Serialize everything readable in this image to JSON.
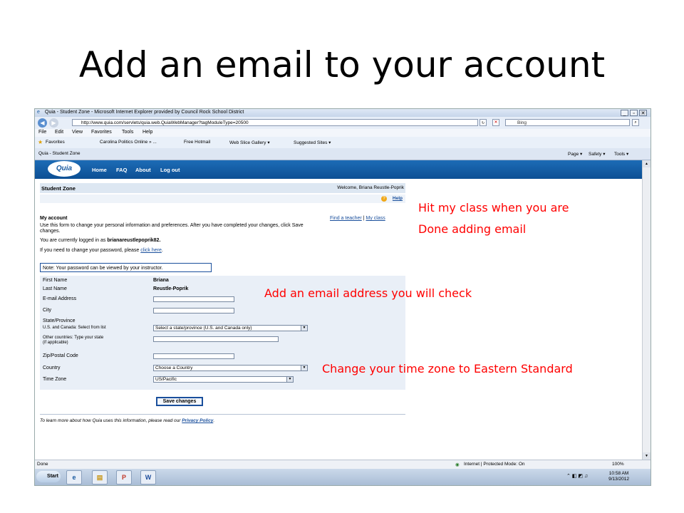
{
  "slide": {
    "title": "Add an email to your account"
  },
  "browser": {
    "window_title": "Quia - Student Zone - Microsoft Internet Explorer provided by Council Rock School District",
    "address": "http://www.quia.com/servlets/quia.web.QuiaWebManager?tagModuleType=20500",
    "search_placeholder": "Bing",
    "menu": [
      "File",
      "Edit",
      "View",
      "Favorites",
      "Tools",
      "Help"
    ],
    "favorites": {
      "label": "Favorites",
      "items": [
        "Carolina Politics Online » ...",
        "Free Hotmail",
        "Web Slice Gallery ▾",
        "Suggested Sites ▾"
      ]
    },
    "tab": "Quia - Student Zone",
    "toolbar": [
      "Page ▾",
      "Safety ▾",
      "Tools ▾"
    ],
    "status_left": "Done",
    "status_zone": "Internet | Protected Mode: On",
    "zoom": "100%"
  },
  "quia": {
    "logo": "Quia",
    "nav": [
      "Home",
      "FAQ",
      "About",
      "Log out"
    ],
    "section": "Student Zone",
    "welcome": "Welcome, Briana Reustle-Poprik",
    "help": "Help",
    "my_account": "My account",
    "find_teacher": "Find a teacher",
    "sep": "|",
    "my_class": "My class",
    "intro_1": "Use this form to change your personal information and preferences. After you have completed your changes, click Save",
    "intro_2": "changes.",
    "logged_in_prefix": "You are currently logged in as ",
    "username": "brianareustlepoprik82.",
    "password_prefix": "If you need to change your password, please ",
    "click_here": "click here",
    "password_suffix": ".",
    "note": "Note: Your password can be viewed by your instructor.",
    "form": {
      "first_name_label": "First Name",
      "first_name": "Briana",
      "last_name_label": "Last Name",
      "last_name": "Reustle-Poprik",
      "email_label": "E-mail Address",
      "email": "",
      "city_label": "City",
      "city": "",
      "state_label": "State/Province",
      "state_sub": "U.S. and Canada: Select from list",
      "state_value": "Select a state/province (U.S. and Canada only)",
      "other_label_1": "Other countries: Type your state",
      "other_label_2": "(if applicable)",
      "zip_label": "Zip/Postal Code",
      "country_label": "Country",
      "country_value": "Choose a Country",
      "tz_label": "Time Zone",
      "tz_value": "US/Pacific"
    },
    "save": "Save changes",
    "footer_prefix": "To learn more about how Quia uses this information, please read our ",
    "privacy": "Privacy Policy",
    "footer_suffix": "."
  },
  "taskbar": {
    "start": "Start",
    "time": "10:58 AM",
    "date": "9/13/2012"
  },
  "annotations": {
    "myclass_1": "Hit my class when you are",
    "myclass_2": "Done adding email",
    "email": "Add an email address you will check",
    "tz": "Change your time zone to Eastern Standard"
  },
  "colors": {
    "annotation": "#ff0000",
    "quia_header": "#1d6cb6",
    "link": "#1a4f9c"
  }
}
